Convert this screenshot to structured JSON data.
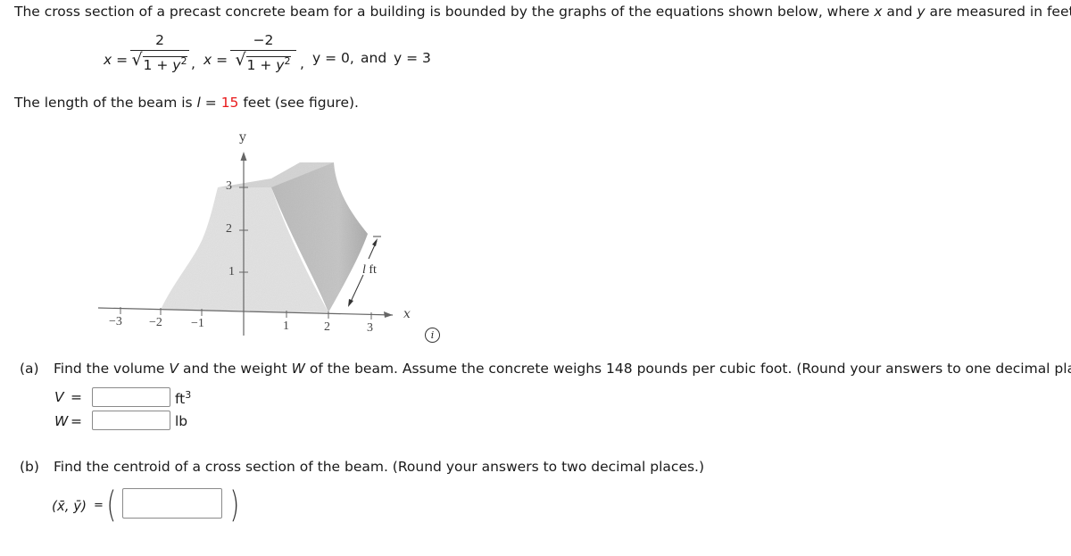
{
  "problem": {
    "intro_pre": "The cross section of a precast concrete beam for a building is bounded by the graphs of the equations shown below, where ",
    "var_x": "x",
    "intro_mid": " and ",
    "var_y": "y",
    "intro_post": " are measured in feet.",
    "equations": {
      "eq1_lhs": "x =",
      "eq1_num": "2",
      "eq1_den_a": "1 + ",
      "eq1_den_b": "y",
      "eq1_den_exp": "2",
      "sep1": ",",
      "eq2_lhs": "x =",
      "eq2_num": "−2",
      "eq2_den_a": "1 + ",
      "eq2_den_b": "y",
      "eq2_den_exp": "2",
      "sep2": ",",
      "eq3": "y = 0,",
      "and": "and",
      "eq4": "y = 3",
      "radical": "√"
    },
    "length_pre": "The length of the beam is ",
    "length_var": "l",
    "length_eq": " = ",
    "length_value": "15",
    "length_post": " feet (see figure).",
    "highlight_color": "#e8191b"
  },
  "figure": {
    "y_axis_label": "y",
    "x_axis_label": "x",
    "y_ticks": [
      "1",
      "2",
      "3"
    ],
    "x_ticks": [
      "−3",
      "−2",
      "−1",
      "1",
      "2",
      "3"
    ],
    "length_label_var": "l",
    "length_label_unit": " ft",
    "info_icon_glyph": "i"
  },
  "part_a": {
    "label": "(a)",
    "prompt_pre": "Find the volume ",
    "var_v": "V",
    "prompt_mid1": " and the weight ",
    "var_w": "W",
    "prompt_post": " of the beam. Assume the concrete weighs 148 pounds per cubic foot. (Round your answers to one decimal place.)",
    "v_label": "V",
    "w_label": "W",
    "equals": "=",
    "v_value": "",
    "w_value": "",
    "v_unit": "ft",
    "v_unit_exp": "3",
    "w_unit": "lb"
  },
  "part_b": {
    "label": "(b)",
    "prompt": "Find the centroid of a cross section of the beam. (Round your answers to two decimal places.)",
    "centroid_label": "(x̄, ȳ)",
    "equals": "=",
    "open_paren": "(",
    "close_paren": ")",
    "value": ""
  }
}
